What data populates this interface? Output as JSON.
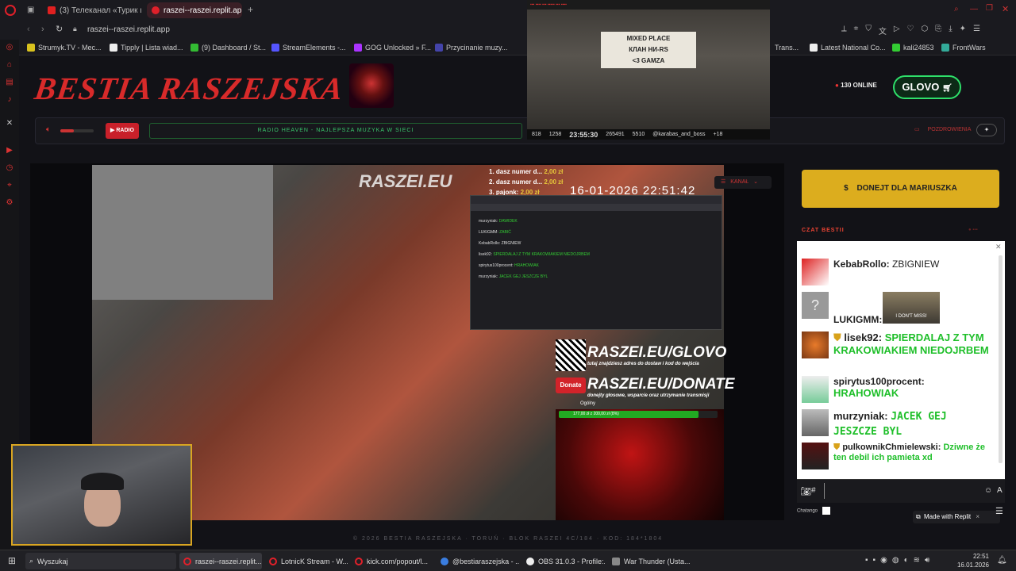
{
  "browser": {
    "tabs": [
      {
        "label": "(3) Телеканал «Турик и К",
        "active": false
      },
      {
        "label": "raszei--raszei.replit.ap",
        "active": true
      }
    ],
    "url": "raszei--raszei.replit.app",
    "bookmarks": [
      "Strumyk.TV - Mec...",
      "Tipply | Lista wiad...",
      "(9) Dashboard / St...",
      "StreamElements -...",
      "GOG Unlocked » F...",
      "Przycinanie muzy...",
      "Trans...",
      "Latest National Co...",
      "kali24853",
      "FrontWars"
    ]
  },
  "site": {
    "logo": "BESTIA RASZEJSKA",
    "online": "130 ONLINE",
    "glovo": "GLOVO",
    "radio_label": "RADIO",
    "ticker": "RADIO HEAVEN - NAJLEPSZA MUZYKA W SIECI",
    "pozdrowienia": "POZDROWIENIA",
    "kanal": "KANAŁ",
    "donate_button": "DONEJT DLA MARIUSZKA",
    "donate_icon": "$",
    "chat_title": "CZAT BESTII",
    "footer": "© 2026 BESTIA RASZEJSKA · TORUŃ · BLOK RASZEI 4C/184 · KOD: 184*1804"
  },
  "webcam": {
    "banner": [
      "MIXED PLACE",
      "КЛАН НИ-RS",
      "<3 GAMZA"
    ],
    "stats": [
      "818",
      "1258",
      "23:55:30",
      "265491",
      "5510",
      "@karabas_and_boss",
      "+18"
    ]
  },
  "video": {
    "watermark": "RASZEI.EU",
    "timestamp": "16-01-2026 22:51:42",
    "donations": [
      {
        "text": "1. dasz numer d...",
        "amount": "2,00 zł"
      },
      {
        "text": "2. dasz numer d...",
        "amount": "2,00 zł"
      },
      {
        "text": "3. pajonk:",
        "amount": "2,00 zł"
      }
    ],
    "overlay_glovo": "RASZEI.EU/GLOVO",
    "overlay_glovo_sub": "tutaj znajdziesz adres do dostaw i kod do wejścia",
    "overlay_donate": "RASZEI.EU/DONATE",
    "overlay_donate_sub": "donejty głosowe, wsparcie oraz utrzymanie transmisji",
    "overlay_donate_badge": "Donate",
    "progress_label": "177,00 zł z 200,00 zł (8%)",
    "progress": 0.88,
    "ogolny": "Ogólny",
    "inner_chat": [
      {
        "user": "murzyniak:",
        "text": "DAWIDEK"
      },
      {
        "user": "LUKIGMM:",
        "text": "ZABIĆ"
      },
      {
        "user": "KebabRollo:",
        "text": "ZBIGNIEW"
      },
      {
        "user": "lisek92:",
        "text": "SPIERDALAJ Z TYM KRAKOWIAKIEM NIEDOJRBEM"
      },
      {
        "user": "spirytus100procent:",
        "text": "HRAHOWIAK"
      },
      {
        "user": "murzyniak:",
        "text": "JACEK GEJ JESZCZE BYL"
      }
    ]
  },
  "chat": {
    "messages": [
      {
        "user": "KebabRollo:",
        "text": "ZBIGNIEW",
        "color": "#222222",
        "badge": false
      },
      {
        "user": "LUKIGMM:",
        "text": "",
        "sticker": "I DON'T MISS!",
        "color": "#222222",
        "badge": false
      },
      {
        "user": "lisek92:",
        "text": "SPIERDALAJ Z TYM KRAKOWIAKIEM NIEDOJRBEM",
        "color": "#1fbf2a",
        "badge": true
      },
      {
        "user": "spirytus100procent:",
        "text": "HRAHOWIAK",
        "color": "#1fbf2a",
        "badge": false
      },
      {
        "user": "murzyniak:",
        "text": "JACEK GEJ JESZCZE BYL",
        "color": "#1fbf2a",
        "badge": false
      },
      {
        "user": "pulkownikChmielewski:",
        "text": "Dziwne że ten debil ich pamieta xd",
        "color": "#1fbf2a",
        "badge": true
      }
    ],
    "chatango_label": "Chatango",
    "made_with": "Made with Replit"
  },
  "taskbar": {
    "search_placeholder": "Wyszukaj",
    "apps": [
      "raszei--raszei.replit....",
      "LotnicK Stream - W...",
      "kick.com/popout/l...",
      "@bestiaraszejska - ...",
      "OBS 31.0.3 - Profile:...",
      "War Thunder (Usta..."
    ],
    "time": "22:51",
    "date": "16.01.2026"
  }
}
